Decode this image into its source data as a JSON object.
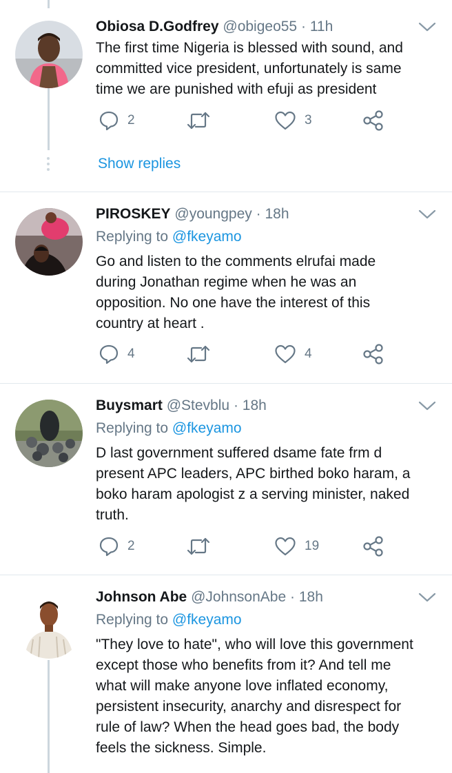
{
  "tweets": [
    {
      "name": "Obiosa D.Godfrey",
      "handle": "@obigeo55",
      "separator": "·",
      "time": "11h",
      "replying_label": "",
      "replying_to": "",
      "lines": [
        "The first time Nigeria is blessed with sound, and",
        "committed vice president,  unfortunately is same",
        "time we are punished with efuji as president"
      ],
      "replies": "2",
      "retweets": "",
      "likes": "3",
      "show_replies": "Show replies"
    },
    {
      "name": "PIROSKEY",
      "handle": "@youngpey",
      "separator": "·",
      "time": "18h",
      "replying_label": "Replying to",
      "replying_to": "@fkeyamo",
      "lines": [
        "Go and listen to the comments elrufai made",
        "during Jonathan regime when he was an",
        "opposition. No one have the interest of this",
        "country at heart ."
      ],
      "replies": "4",
      "retweets": "",
      "likes": "4"
    },
    {
      "name": "Buysmart",
      "handle": "@Stevblu",
      "separator": "·",
      "time": "18h",
      "replying_label": "Replying to",
      "replying_to": "@fkeyamo",
      "lines": [
        "D last government suffered dsame fate frm d",
        "present APC leaders, APC birthed boko haram, a",
        "boko haram apologist z a serving minister, naked",
        "truth."
      ],
      "replies": "2",
      "retweets": "",
      "likes": "19"
    },
    {
      "name": "Johnson Abe",
      "handle": "@JohnsonAbe",
      "separator": "·",
      "time": "18h",
      "replying_label": "Replying to",
      "replying_to": "@fkeyamo",
      "lines": [
        "\"They love to hate\", who will love this government",
        "except those who benefits from it? And tell me",
        "what will make anyone love inflated economy,",
        "persistent insecurity, anarchy and disrespect for",
        "rule of law? When the head goes bad, the body",
        "feels the sickness. Simple."
      ]
    }
  ],
  "icons": {
    "reply": "reply-icon",
    "retweet": "retweet-icon",
    "like": "heart-icon",
    "share": "share-icon",
    "more": "chevron-down-icon"
  },
  "colors": {
    "link": "#1b95e0",
    "secondary_text": "#657786",
    "icon_gray": "#657786",
    "divider": "#e1e8ed",
    "thread_line": "#ccd6dd"
  }
}
